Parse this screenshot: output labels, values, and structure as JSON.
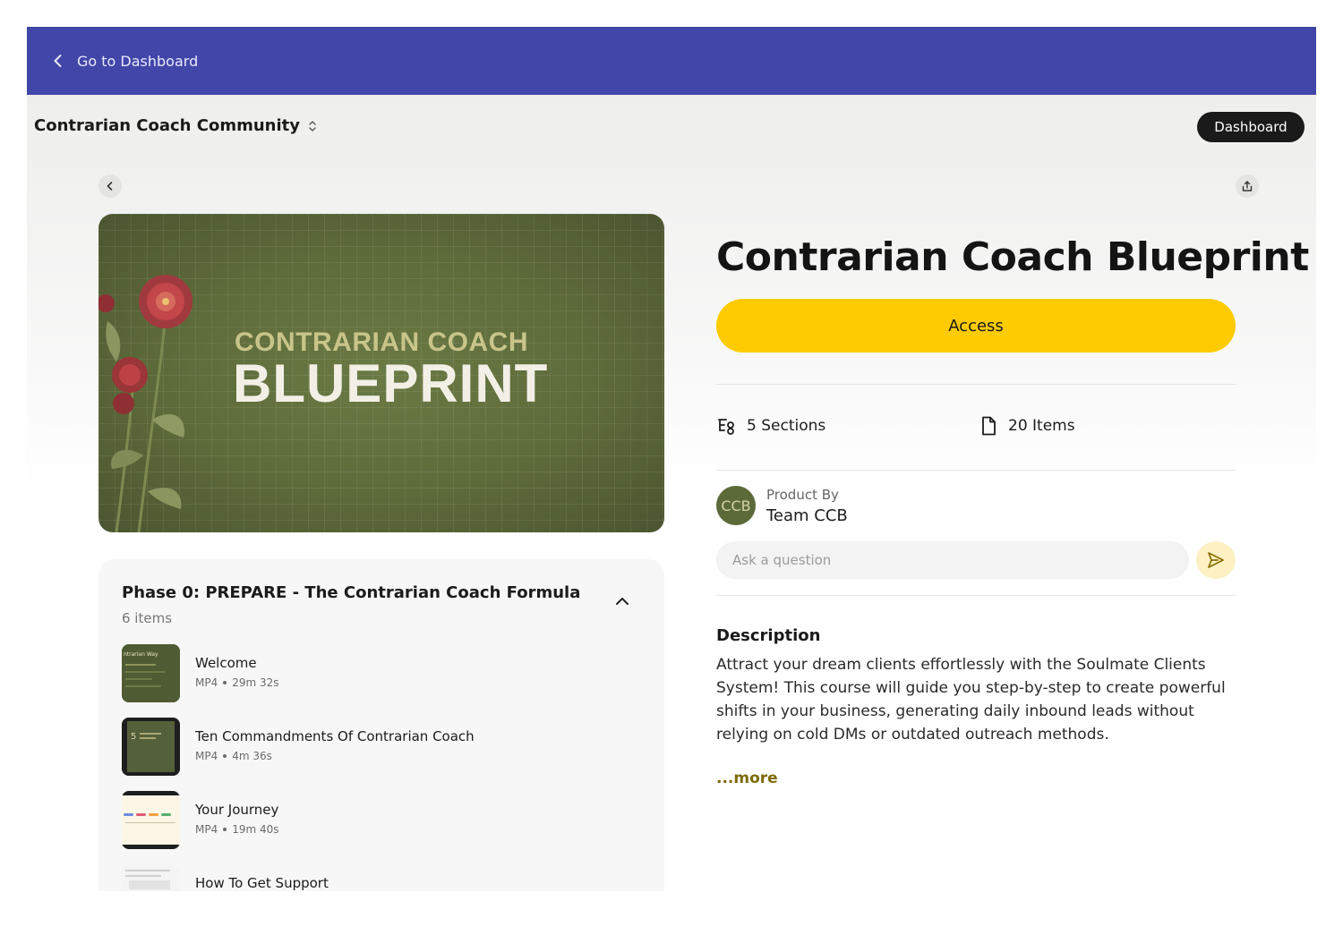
{
  "topbar": {
    "back_label": "Go to Dashboard",
    "color": "#4146a8"
  },
  "community": {
    "name": "Contrarian Coach Community"
  },
  "header": {
    "dashboard_label": "Dashboard"
  },
  "banner": {
    "subtitle": "CONTRARIAN COACH",
    "title": "BLUEPRINT"
  },
  "course": {
    "title": "Contrarian Coach Blueprint",
    "access_label": "Access",
    "accent_color": "#fdcb00",
    "sections": "5 Sections",
    "items": "20 Items",
    "product_by_label": "Product By",
    "author": "Team CCB",
    "avatar_initials": "CCB",
    "ask_placeholder": "Ask a question",
    "description_heading": "Description",
    "description": "Attract your dream clients effortlessly with the Soulmate Clients System! This course will guide you step-by-step to create powerful shifts in your business, generating daily inbound leads without relying on cold DMs or outdated outreach methods.",
    "more_label": "...more"
  },
  "phase": {
    "title": "Phase 0: PREPARE - The Contrarian Coach Formula",
    "count": "6 items",
    "lessons": [
      {
        "title": "Welcome",
        "format": "MP4",
        "duration": "29m 32s",
        "thumb_text": "ntrarian Way"
      },
      {
        "title": "Ten Commandments Of Contrarian Coach",
        "format": "MP4",
        "duration": "4m 36s",
        "thumb_text": "5"
      },
      {
        "title": "Your Journey",
        "format": "MP4",
        "duration": "19m 40s",
        "thumb_text": ""
      },
      {
        "title": "How To Get Support",
        "format": "",
        "duration": "",
        "thumb_text": ""
      }
    ]
  }
}
